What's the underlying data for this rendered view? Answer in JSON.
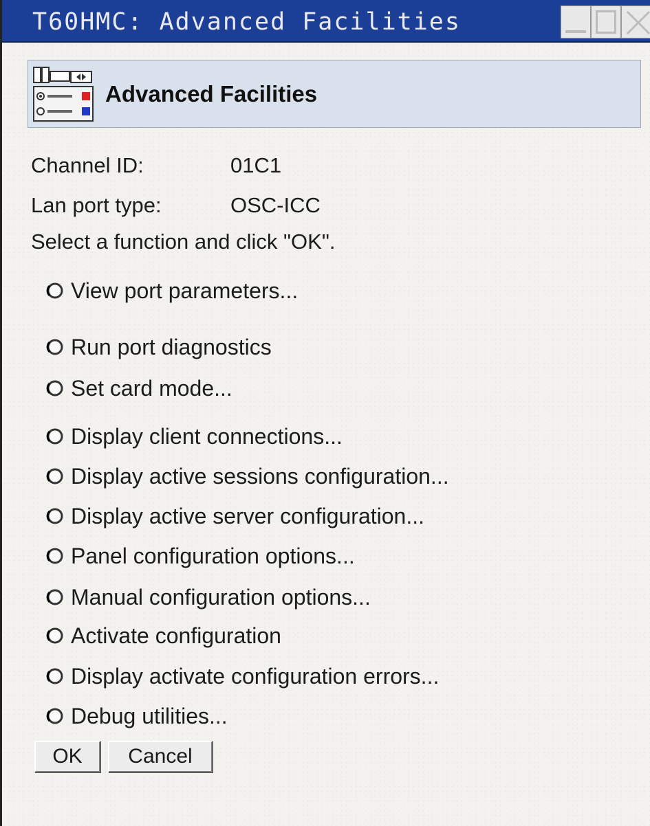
{
  "window": {
    "title": "T60HMC: Advanced Facilities"
  },
  "header": {
    "title": "Advanced Facilities",
    "icon": "control-panel-icon"
  },
  "info": {
    "channel_id_label": "Channel ID:",
    "channel_id_value": "01C1",
    "lan_port_label": "Lan port type:",
    "lan_port_value": "OSC-ICC",
    "instruction": "Select a function and click \"OK\"."
  },
  "options": [
    {
      "label": "View port parameters..."
    },
    {
      "label": "Run port diagnostics"
    },
    {
      "label": "Set card mode..."
    },
    {
      "label": "Display client connections..."
    },
    {
      "label": "Display active sessions configuration..."
    },
    {
      "label": "Display active server configuration..."
    },
    {
      "label": "Panel configuration options..."
    },
    {
      "label": "Manual configuration options..."
    },
    {
      "label": "Activate configuration"
    },
    {
      "label": "Display activate configuration errors..."
    },
    {
      "label": "Debug utilities..."
    }
  ],
  "buttons": {
    "ok": "OK",
    "cancel": "Cancel"
  },
  "colors": {
    "titlebar": "#1b3f97",
    "header_panel": "#d9e2ec"
  }
}
